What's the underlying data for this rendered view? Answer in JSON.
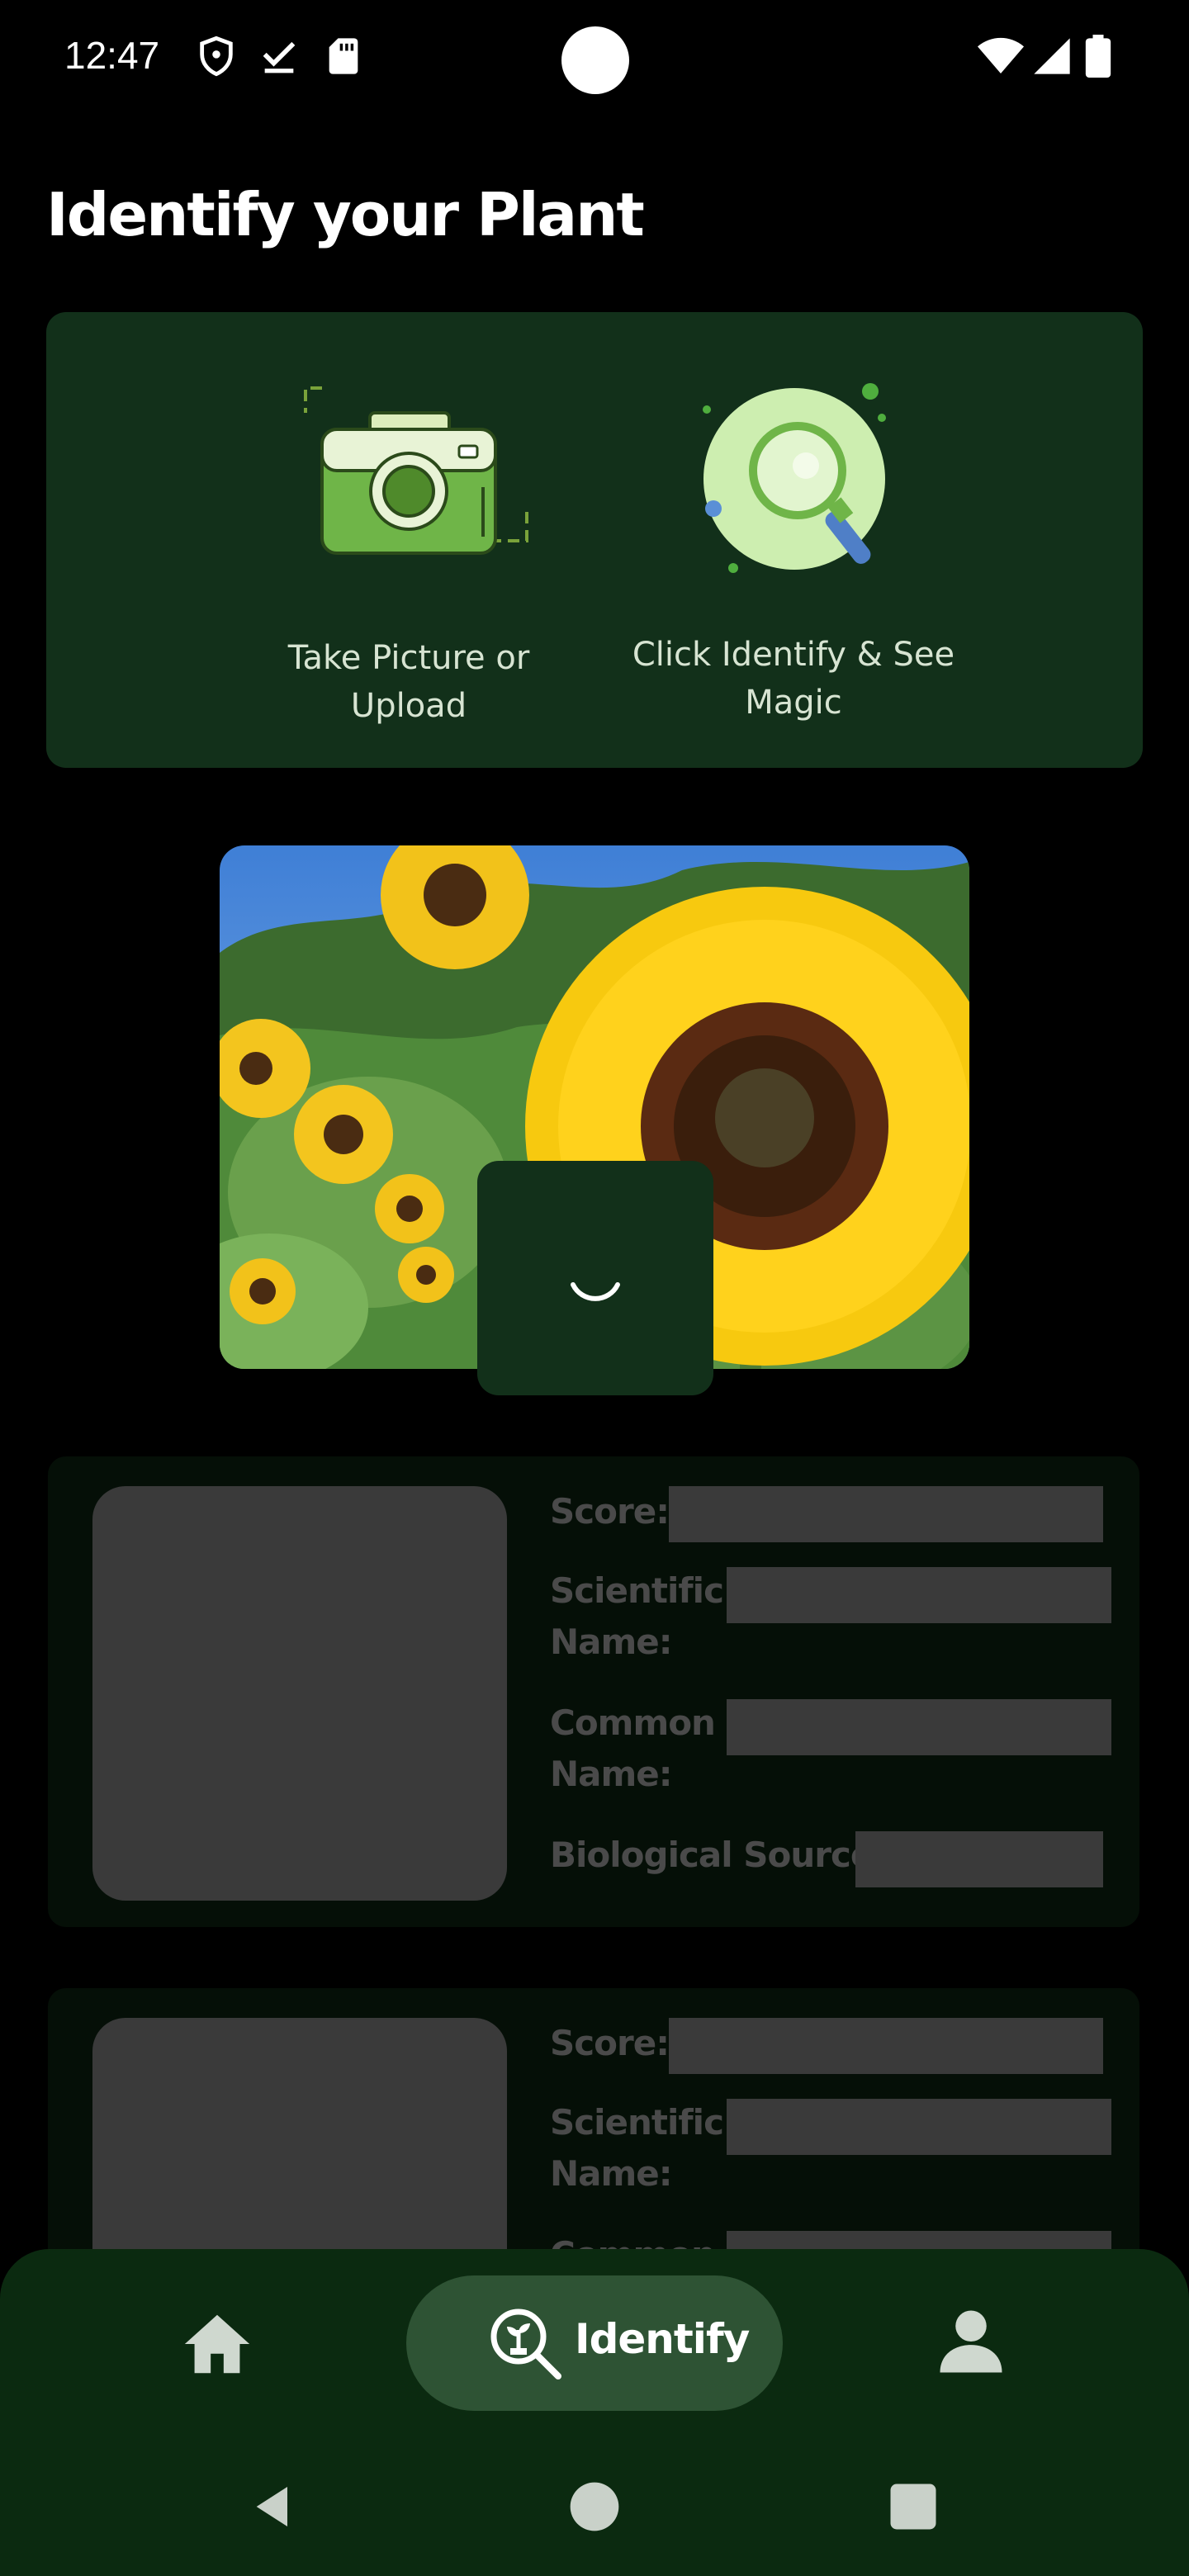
{
  "status_bar": {
    "time": "12:47",
    "icons": [
      "shield-icon",
      "download-done-icon",
      "sd-card-icon",
      "wifi-icon",
      "signal-icon",
      "battery-icon"
    ]
  },
  "page": {
    "title": "Identify your Plant"
  },
  "steps": [
    {
      "icon": "camera-icon",
      "label_line1": "Take Picture or",
      "label_line2": "Upload"
    },
    {
      "icon": "magnifier-icon",
      "label_line1": "Click Identify & See",
      "label_line2": "Magic"
    }
  ],
  "preview": {
    "image": "sunflower-photo",
    "loading": true
  },
  "result_labels": {
    "score": "Score:",
    "scientific_line1": "Scientific",
    "scientific_line2": "Name:",
    "common_line1": "Common",
    "common_line2": "Name:",
    "source": "Biological Source:"
  },
  "bottom_nav": {
    "items": [
      {
        "icon": "home-icon",
        "label": ""
      },
      {
        "icon": "plant-search-icon",
        "label": "Identify",
        "active": true
      },
      {
        "icon": "profile-icon",
        "label": ""
      }
    ]
  },
  "system_nav": [
    "back-icon",
    "home-circle-icon",
    "recents-icon"
  ],
  "colors": {
    "background": "#000000",
    "card": "#12301a",
    "nav": "#0b2a10",
    "nav_active": "#2e5334",
    "placeholder": "#3a3a3a"
  }
}
